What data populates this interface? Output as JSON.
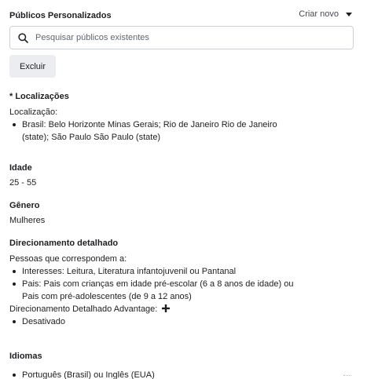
{
  "header": {
    "title": "Públicos Personalizados",
    "create_new": "Criar novo"
  },
  "search": {
    "placeholder": "Pesquisar públicos existentes"
  },
  "exclude_button": "Excluir",
  "locations": {
    "title": "* Localizações",
    "label": "Localização:",
    "items": [
      "Brasil: Belo Horizonte Minas Gerais; Rio de Janeiro Rio de Janeiro (state); São Paulo São Paulo (state)"
    ]
  },
  "age": {
    "title": "Idade",
    "value": "25 - 55"
  },
  "gender": {
    "title": "Gênero",
    "value": "Mulheres"
  },
  "detailed_targeting": {
    "title": "Direcionamento detalhado",
    "intro": "Pessoas que correspondem a:",
    "items": [
      "Interesses: Leitura, Literatura infantojuvenil ou Pantanal",
      "Pais: Pais com crianças em idade pré-escolar (6 a 8 anos de idade) ou Pais com pré-adolescentes (de 9 a 12 anos)"
    ],
    "advantage_label": "Direcionamento Detalhado Advantage:",
    "advantage_items": [
      "Desativado"
    ]
  },
  "languages": {
    "title": "Idiomas",
    "items": [
      "Português (Brasil) ou Inglês (EUA)"
    ]
  },
  "colors": {
    "text": "#1c1e21",
    "border": "#ccd0d5",
    "button_bg": "#ebedf0"
  }
}
